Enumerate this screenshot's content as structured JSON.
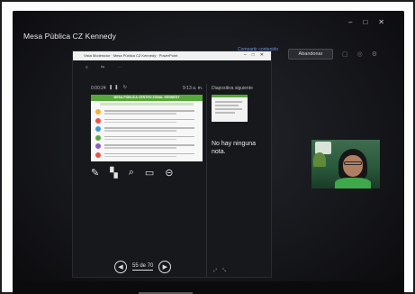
{
  "meeting": {
    "title": "Mesa Pública CZ Kennedy",
    "share_label": "Compartir contenido",
    "leave_label": "Abandonar"
  },
  "window_controls": [
    "–",
    "□",
    "✕"
  ],
  "presenter_window": {
    "title": "Vista Moderador · Mesa Pública CZ Kennedy · PowerPoint",
    "controls": [
      "–",
      "□",
      "✕"
    ],
    "menu": [
      "≡",
      "⇆",
      "⋯"
    ],
    "timer": "0:00:24",
    "timer_controls": "❚❚ ↻",
    "clock": "9:13 a. m.",
    "current_slide": {
      "title": "MESA PÚBLICA CENTRO ZONAL KENNEDY",
      "row_colors": [
        "#f2b233",
        "#e8544a",
        "#3c9ad6",
        "#57a83a",
        "#8a5cc4",
        "#e8544a"
      ]
    },
    "tools": [
      "pen-icon",
      "laser-icon",
      "zoom-icon",
      "screen-icon",
      "more-icon"
    ],
    "next_slide_label": "Diapositiva siguiente",
    "notes": "No hay ninguna nota.",
    "nav": {
      "prev": "◀",
      "counter": "55 de 70",
      "next": "▶"
    },
    "corner_icons": [
      "⤢",
      "⤡"
    ]
  },
  "colors": {
    "accent_green": "#57a83a",
    "background": "#15161a"
  }
}
